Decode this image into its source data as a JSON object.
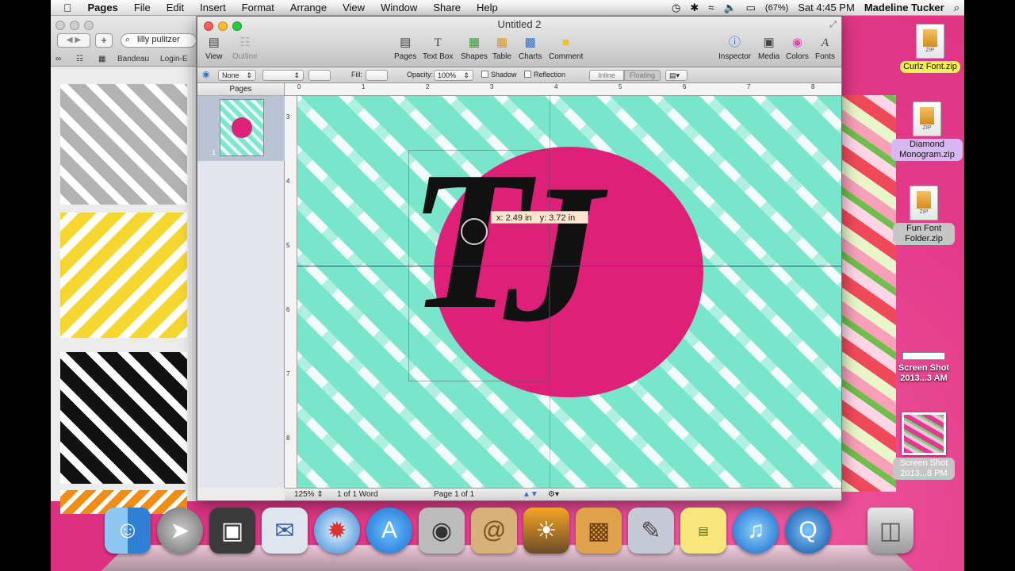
{
  "menubar": {
    "apple_icon": "apple-logo-icon",
    "app_name": "Pages",
    "items": [
      "File",
      "Edit",
      "Insert",
      "Format",
      "Arrange",
      "View",
      "Window",
      "Share",
      "Help"
    ],
    "battery": "(67%)",
    "clock": "Sat 4:45 PM",
    "user": "Madeline Tucker"
  },
  "safari": {
    "search_value": "lilly pulitzer",
    "bookmarks": [
      "Bandeau",
      "Login-E"
    ]
  },
  "pages_window": {
    "title": "Untitled 2",
    "toolbar": {
      "view": "View",
      "outline": "Outline",
      "pages": "Pages",
      "textbox": "Text Box",
      "shapes": "Shapes",
      "table": "Table",
      "charts": "Charts",
      "comment": "Comment",
      "inspector": "Inspector",
      "media": "Media",
      "colors": "Colors",
      "fonts": "Fonts",
      "colors2": "olors",
      "fonts2": "Fonts"
    },
    "format_bar": {
      "stroke": "None",
      "fill_label": "Fill:",
      "opacity_label": "Opacity:",
      "opacity_value": "100%",
      "shadow": "Shadow",
      "reflection": "Reflection",
      "inline": "Inline",
      "floating": "Floating"
    },
    "sidebar": {
      "header": "Pages",
      "page_number": "1"
    },
    "ruler_h": [
      "0",
      "1",
      "2",
      "3",
      "4",
      "5",
      "6",
      "7",
      "8"
    ],
    "ruler_v": [
      "3",
      "4",
      "5",
      "6",
      "7",
      "8"
    ],
    "canvas": {
      "monogram_left": "T",
      "monogram_right": "J",
      "coord_x": "x: 2.49 in",
      "coord_y": "y: 3.72 in"
    },
    "status": {
      "zoom": "125%",
      "words": "1 of 1 Word",
      "page": "Page 1 of 1"
    }
  },
  "desktop_icons": [
    {
      "label": "Curlz Font.zip",
      "badge": "ZIP"
    },
    {
      "label": "Diamond Monogram.zip",
      "badge": "ZIP"
    },
    {
      "label": "Fun Font Folder.zip",
      "badge": "ZIP"
    },
    {
      "label": "Screen Shot 2013...3 AM"
    },
    {
      "label": "Screen Shot 2013...8 PM"
    }
  ],
  "dock": [
    "finder-icon",
    "launchpad-icon",
    "photo-booth-icon",
    "mail-icon",
    "safari-icon",
    "app-store-icon",
    "facetime-icon",
    "address-book-icon",
    "iphoto-icon",
    "archive-utility-icon",
    "script-editor-icon",
    "stickies-icon",
    "itunes-icon",
    "quicktime-icon",
    "trash-icon"
  ],
  "colors": {
    "pink": "#df2079",
    "mint": "#79e6cb",
    "accent_blue": "#3b3bd8"
  }
}
